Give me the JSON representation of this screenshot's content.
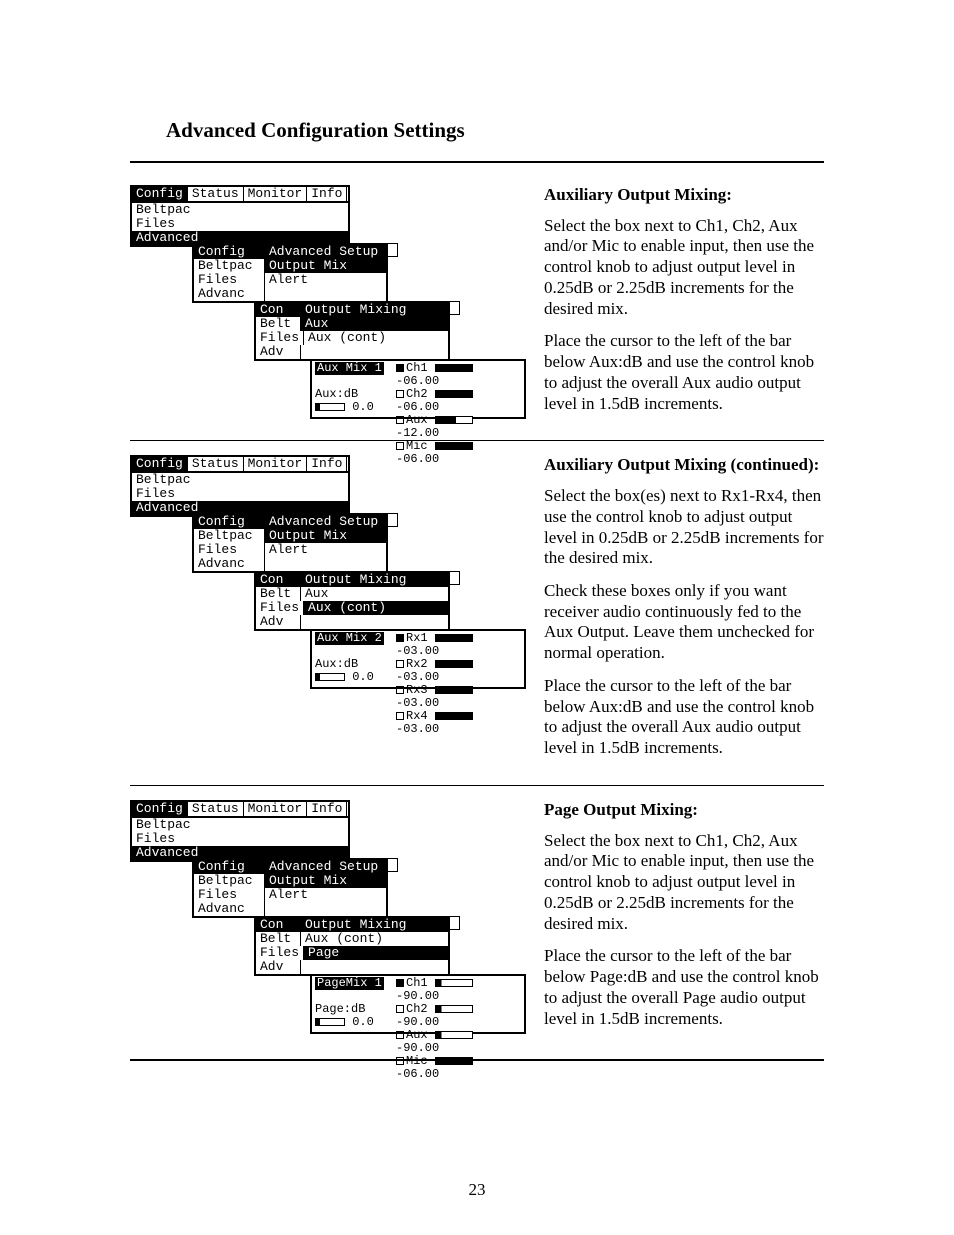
{
  "page_number": "23",
  "title": "Advanced Configuration Settings",
  "menu_tabs": [
    "Config",
    "Status",
    "Monitor",
    "Info"
  ],
  "menu_l1_items": [
    "Beltpac",
    "Files",
    "Advanced"
  ],
  "menu_l2_left": [
    "Config",
    "Beltpac",
    "Files",
    "Advanc"
  ],
  "menu_l2_right": [
    "Advanced Setup",
    "Output Mix",
    "Alert"
  ],
  "menu_l3_left": [
    "Con",
    "Belt",
    "Files",
    "Adv"
  ],
  "sections": [
    {
      "heading": "Auxiliary Output Mixing:",
      "paras": [
        "Select the box next to Ch1, Ch2, Aux and/or Mic to enable input, then use the control knob to adjust output level in 0.25dB or 2.25dB increments for the desired mix.",
        "Place the cursor to the left of the bar below Aux:dB and use the control knob to adjust the overall Aux audio output level in 1.5dB increments."
      ],
      "l3_right": [
        "Output Mixing",
        "Aux",
        "Aux (cont)"
      ],
      "l3_sel_index": 1,
      "final_title": "Aux Mix 1",
      "final_left_label": "Aux:dB",
      "final_left_value": "0.0",
      "final_rows": [
        {
          "check": true,
          "label": "Ch1",
          "bar": "full",
          "value": "-06.00"
        },
        {
          "check": false,
          "label": "Ch2",
          "bar": "full",
          "value": "-06.00"
        },
        {
          "check": false,
          "label": "Aux",
          "bar": "half",
          "value": "-12.00"
        },
        {
          "check": false,
          "label": "Mic",
          "bar": "full",
          "value": "-06.00"
        }
      ]
    },
    {
      "heading": "Auxiliary Output Mixing (continued):",
      "paras": [
        "Select the box(es) next to Rx1-Rx4, then use the control knob to adjust output level in 0.25dB or 2.25dB increments for the desired mix.",
        "Check these boxes only if you want receiver audio continuously fed to the Aux Output.  Leave them unchecked for normal operation.",
        "Place the cursor to the left of the bar below Aux:dB and use the control knob to adjust the overall Aux audio output level in 1.5dB increments."
      ],
      "l3_right": [
        "Output Mixing",
        "Aux",
        "Aux (cont)"
      ],
      "l3_sel_index": 2,
      "final_title": "Aux Mix 2",
      "final_left_label": "Aux:dB",
      "final_left_value": "0.0",
      "final_rows": [
        {
          "check": true,
          "label": "Rx1",
          "bar": "full",
          "value": "-03.00"
        },
        {
          "check": false,
          "label": "Rx2",
          "bar": "full",
          "value": "-03.00"
        },
        {
          "check": false,
          "label": "Rx3",
          "bar": "full",
          "value": "-03.00"
        },
        {
          "check": false,
          "label": "Rx4",
          "bar": "full",
          "value": "-03.00"
        }
      ]
    },
    {
      "heading": "Page Output Mixing:",
      "paras": [
        "Select the box next to Ch1, Ch2, Aux and/or Mic to enable input, then use the control knob to adjust output level in 0.25dB or 2.25dB increments for the desired mix.",
        "Place the cursor to the left of the bar below Page:dB and use the control knob to adjust the overall Page audio output level in 1.5dB increments."
      ],
      "l3_right": [
        "Output Mixing",
        "Aux (cont)",
        "Page"
      ],
      "l3_sel_index": 2,
      "final_title": "PageMix 1",
      "final_left_label": "Page:dB",
      "final_left_value": "0.0",
      "final_rows": [
        {
          "check": true,
          "label": "Ch1",
          "bar": "low",
          "value": "-90.00"
        },
        {
          "check": false,
          "label": "Ch2",
          "bar": "low",
          "value": "-90.00"
        },
        {
          "check": false,
          "label": "Aux",
          "bar": "low",
          "value": "-90.00"
        },
        {
          "check": false,
          "label": "Mic",
          "bar": "full",
          "value": "-06.00"
        }
      ]
    }
  ]
}
